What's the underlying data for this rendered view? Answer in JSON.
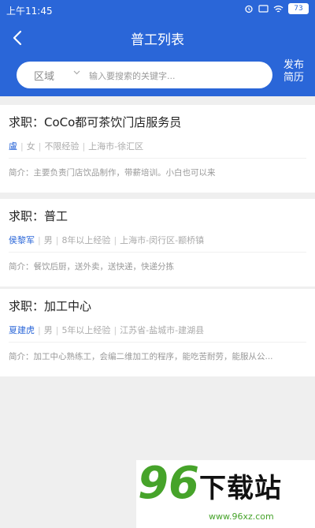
{
  "status": {
    "time": "上午11:45",
    "battery": "73"
  },
  "header": {
    "title": "普工列表",
    "publish": "发布简历"
  },
  "search": {
    "region": "区域",
    "placeholder": "输入要搜索的关键字..."
  },
  "jobs": [
    {
      "title": "求职：CoCo都可茶饮门店服务员",
      "name": "盧",
      "gender": "女",
      "experience": "不限经验",
      "location": "上海市-徐汇区",
      "intro": "简介：主要负责门店饮品制作，带薪培训。小白也可以来"
    },
    {
      "title": "求职：普工",
      "name": "侯黎军",
      "gender": "男",
      "experience": "8年以上经验",
      "location": "上海市-闵行区-颛桥镇",
      "intro": "简介：餐饮后厨，送外卖，送快递，快递分拣"
    },
    {
      "title": "求职：加工中心",
      "name": "夏建虎",
      "gender": "男",
      "experience": "5年以上经验",
      "location": "江苏省-盐城市-建湖县",
      "intro": "简介：加工中心熟练工，会编二维加工的程序，能吃苦耐劳，能服从公..."
    }
  ],
  "watermark": {
    "text": "下载站",
    "url": "www.96xz.com"
  }
}
